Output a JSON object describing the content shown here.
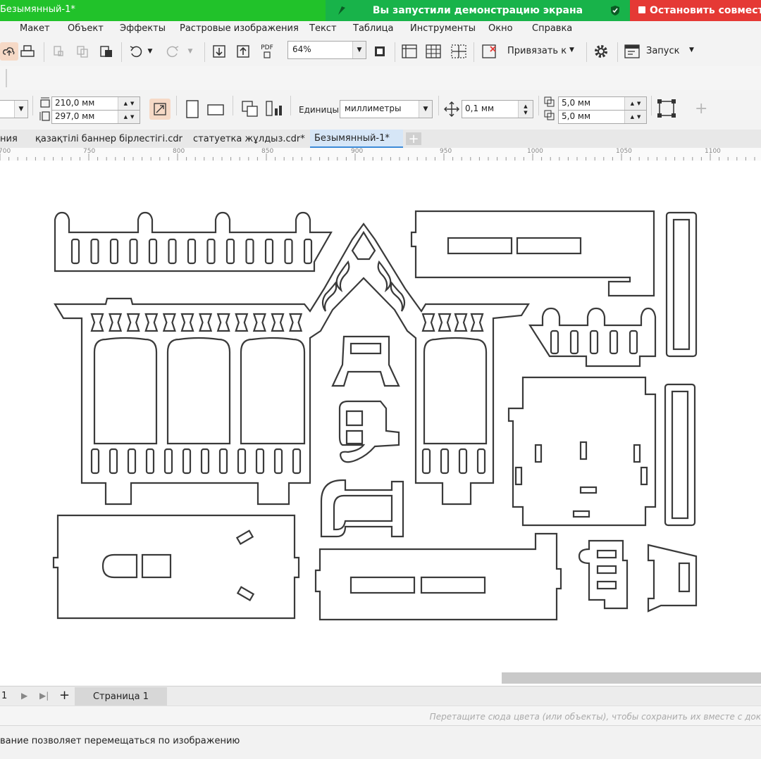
{
  "window": {
    "title": "Безымянный-1*"
  },
  "screen_share": {
    "banner_text": "Вы запустили демонстрацию экрана",
    "stop_label": "Остановить совместн"
  },
  "menu": [
    "Макет",
    "Объект",
    "Эффекты",
    "Растровые изображения",
    "Текст",
    "Таблица",
    "Инструменты",
    "Окно",
    "Справка"
  ],
  "toolbar": {
    "zoom_value": "64%",
    "snap_label": "Привязать к",
    "launch_label": "Запуск",
    "pdf_label": "PDF"
  },
  "property_bar": {
    "width_value": "210,0 мм",
    "height_value": "297,0 мм",
    "units_label": "Единицы:",
    "units_value": "миллиметры",
    "nudge_value": "0,1 мм",
    "dup_x_value": "5,0 мм",
    "dup_y_value": "5,0 мм"
  },
  "tabs": [
    {
      "label": "ния",
      "active": false
    },
    {
      "label": "қазақтілі баннер бірлестігі.cdr",
      "active": false
    },
    {
      "label": "статуетка жұлдыз.cdr*",
      "active": false
    },
    {
      "label": "Безымянный-1*",
      "active": true
    }
  ],
  "ruler": {
    "ticks": [
      "700",
      "750",
      "800",
      "850",
      "900",
      "950",
      "1000",
      "1050",
      "1100"
    ]
  },
  "page_nav": {
    "page_number": "1",
    "page_tab": "Страница 1"
  },
  "palette_hint": "Перетащите сюда цвета (или объекты), чтобы сохранить их вместе с док",
  "status": {
    "text": "вание позволяет перемещаться по изображению"
  },
  "colors": {
    "titlebar": "#21c22a",
    "share_banner": "#18b34a",
    "stop_button": "#e53935",
    "active_tab": "#d6e6f7"
  }
}
